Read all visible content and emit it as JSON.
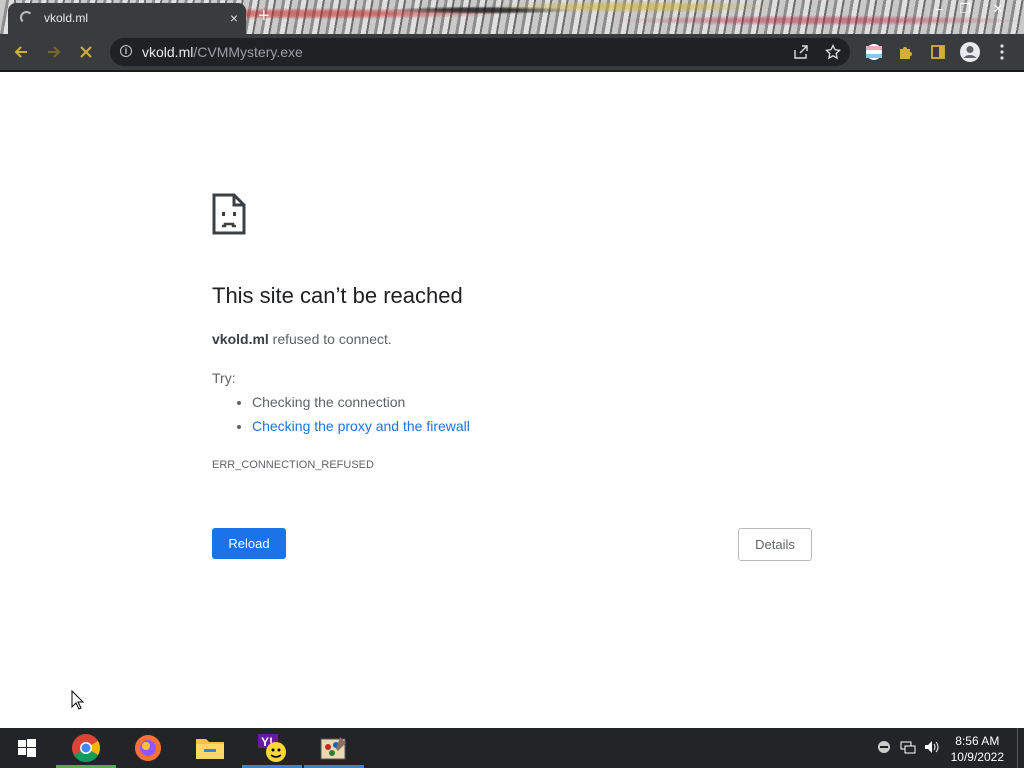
{
  "browser": {
    "tab_title": "vkold.ml",
    "tab_close": "×",
    "new_tab": "+",
    "url_host": "vkold.ml",
    "url_path": "/CVMMystery.exe"
  },
  "window": {
    "minimize": "–",
    "restore": "❐",
    "close": "✕"
  },
  "error_page": {
    "heading": "This site can’t be reached",
    "host": "vkold.ml",
    "message_suffix": " refused to connect.",
    "try_label": "Try:",
    "suggestions": [
      "Checking the connection",
      "Checking the proxy and the firewall"
    ],
    "error_code": "ERR_CONNECTION_REFUSED",
    "reload_label": "Reload",
    "details_label": "Details"
  },
  "taskbar": {
    "apps": [
      "start-icon",
      "chrome-icon",
      "firefox-icon",
      "file-explorer-icon",
      "yahoo-messenger-icon",
      "paint-app-icon"
    ],
    "time": "8:56 AM",
    "date": "10/9/2022"
  },
  "colors": {
    "accent": "#1a73e8",
    "toolbar": "#3a3b3c",
    "taskbar": "#222427"
  }
}
